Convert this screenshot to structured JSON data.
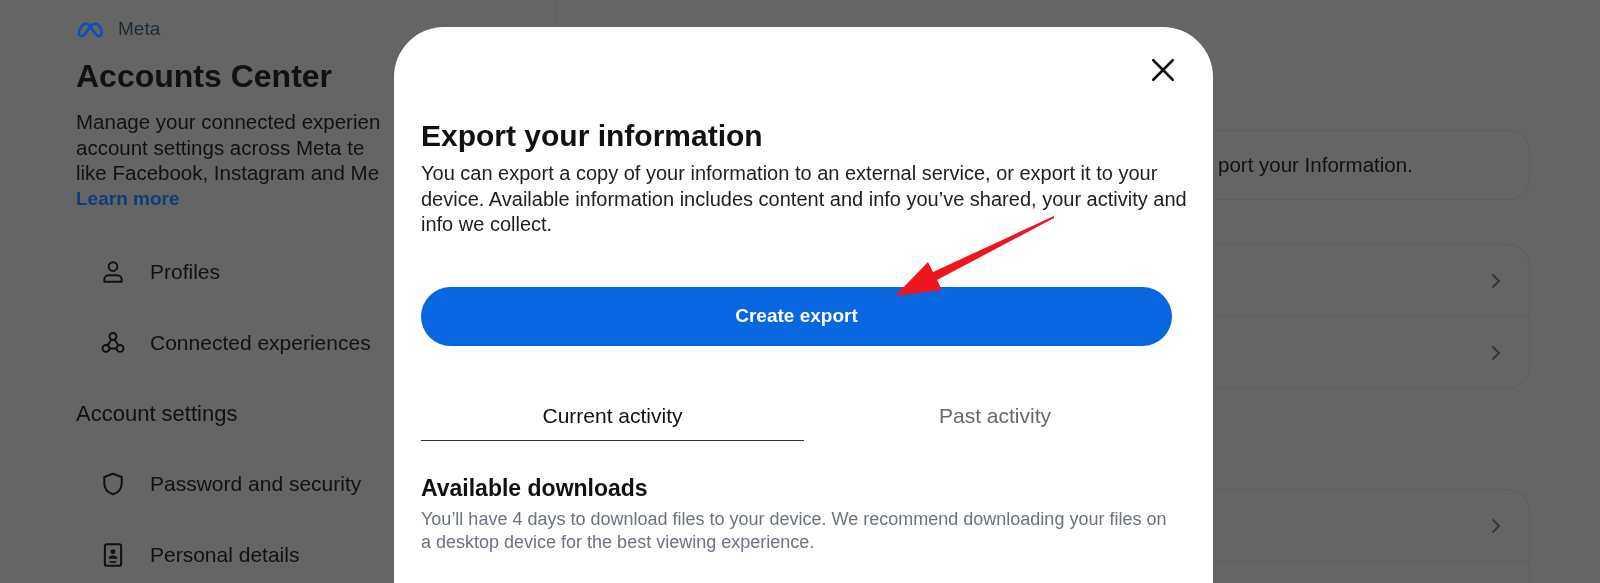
{
  "sidebar": {
    "logo_text": "Meta",
    "title": "Accounts Center",
    "description_lines": [
      "Manage your connected experien",
      "account settings across Meta te",
      "like Facebook, Instagram and Me"
    ],
    "link": "Learn more",
    "items": [
      {
        "label": "Profiles"
      },
      {
        "label": "Connected experiences"
      }
    ],
    "account_settings": {
      "heading": "Account settings",
      "items": [
        {
          "label": "Password and security"
        },
        {
          "label": "Personal details"
        }
      ]
    }
  },
  "main": {
    "notice": "port your Information."
  },
  "modal": {
    "title": "Export your information",
    "description": "You can export a copy of your information to an external service, or export it to your device. Available information includes content and info you’ve shared, your activity and info we collect.",
    "primary_button": "Create export",
    "tabs": [
      {
        "label": "Current activity",
        "selected": true
      },
      {
        "label": "Past activity",
        "selected": false
      }
    ],
    "section": {
      "heading": "Available downloads",
      "text": "You’ll have 4 days to download files to your device. We recommend downloading your files on a desktop device for the best viewing experience."
    }
  }
}
